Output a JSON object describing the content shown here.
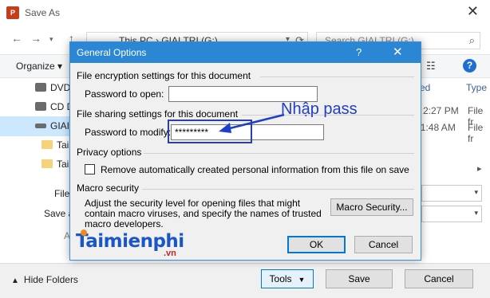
{
  "save_as": {
    "title": "Save As",
    "app_icon": "P",
    "address": "This PC  ›  GIAI TRI (G:)",
    "search_placeholder": "Search GIAI TRI (G:)",
    "organize": "Organize ▾",
    "nav_items": [
      {
        "label": "DVD",
        "icon": "dvd-drive-icon"
      },
      {
        "label": "CD D",
        "icon": "cd-drive-icon"
      },
      {
        "label": "GIAI",
        "icon": "drive-icon"
      },
      {
        "label": "Tain",
        "icon": "folder-icon"
      },
      {
        "label": "Tair",
        "icon": "folder-icon"
      }
    ],
    "columns": {
      "modified": "fied",
      "type": "Type"
    },
    "rows": [
      {
        "time": "2:27 PM",
        "type": "File fr"
      },
      {
        "time": "11:48 AM",
        "type": "File fr"
      }
    ],
    "file_name_label": "File",
    "save_as_type_label": "Save a",
    "authors_label": "A",
    "hide_folders": "Hide Folders",
    "tools": "Tools",
    "save": "Save",
    "cancel": "Cancel"
  },
  "dialog": {
    "title": "General Options",
    "help": "?",
    "close": "✕",
    "encryption_header": "File encryption settings for this document",
    "password_open_label": "Password to open:",
    "password_open_value": "",
    "sharing_header": "File sharing settings for this document",
    "password_modify_label": "Password to modify:",
    "password_modify_value": "*********",
    "privacy_header": "Privacy options",
    "privacy_checkbox_label": "Remove automatically created personal information from this file on save",
    "privacy_checked": false,
    "macro_header": "Macro security",
    "macro_desc_lines": [
      "Adjust the security level for opening files that might",
      "contain macro viruses, and specify the names of trusted",
      "macro developers."
    ],
    "macro_button": "Macro Security...",
    "ok": "OK",
    "cancel": "Cancel"
  },
  "annotation": {
    "text": "Nhập pass",
    "color": "#1f3ec9"
  },
  "watermark": {
    "main": "Taimienphi",
    "sub": ".vn"
  },
  "colors": {
    "titlebar": "#2b86d3",
    "accent": "#0078d7",
    "annotation": "#1f3ec9"
  }
}
